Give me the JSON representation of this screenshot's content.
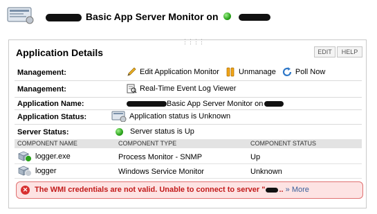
{
  "header": {
    "title": "Basic App Server Monitor on"
  },
  "panel": {
    "title": "Application Details",
    "edit_label": "EDIT",
    "help_label": "HELP",
    "management_label": "Management:",
    "edit_app_monitor": "Edit Application Monitor",
    "unmanage": "Unmanage",
    "poll_now": "Poll Now",
    "event_log_viewer": "Real-Time Event Log Viewer",
    "app_name_label": "Application Name:",
    "app_name_value": "Basic App Server Monitor on",
    "app_status_label": "Application Status:",
    "app_status_value": "Application status is Unknown",
    "server_status_label": "Server Status:",
    "server_status_value": "Server status is Up"
  },
  "table": {
    "headers": [
      "COMPONENT NAME",
      "COMPONENT TYPE",
      "COMPONENT STATUS"
    ],
    "rows": [
      {
        "name": "logger.exe",
        "type": "Process Monitor - SNMP",
        "status": "Up"
      },
      {
        "name": "logger",
        "type": "Windows Service Monitor",
        "status": "Unknown"
      }
    ]
  },
  "error": {
    "message": "The WMI credentials are not valid. Unable to connect to server \"",
    "more": "» More"
  },
  "colors": {
    "error_text": "#c21a1a",
    "status_up": "#2aa31b",
    "link": "#3a5f9a"
  }
}
